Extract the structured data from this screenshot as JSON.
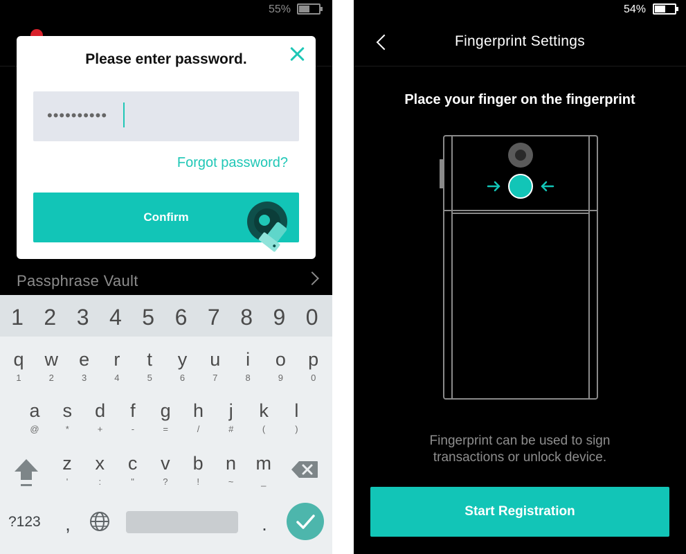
{
  "left": {
    "status_bar": {
      "battery_text": "55%",
      "battery_level": 0.55
    },
    "dialog": {
      "title": "Please enter password.",
      "password_value": "••••••••••",
      "forgot_label": "Forgot password?",
      "confirm_label": "Confirm"
    },
    "vault_label": "Passphrase Vault",
    "keyboard": {
      "numbers": [
        "1",
        "2",
        "3",
        "4",
        "5",
        "6",
        "7",
        "8",
        "9",
        "0"
      ],
      "row1": [
        {
          "k": "q",
          "s": "1"
        },
        {
          "k": "w",
          "s": "2"
        },
        {
          "k": "e",
          "s": "3"
        },
        {
          "k": "r",
          "s": "4"
        },
        {
          "k": "t",
          "s": "5"
        },
        {
          "k": "y",
          "s": "6"
        },
        {
          "k": "u",
          "s": "7"
        },
        {
          "k": "i",
          "s": "8"
        },
        {
          "k": "o",
          "s": "9"
        },
        {
          "k": "p",
          "s": "0"
        }
      ],
      "row2": [
        {
          "k": "a",
          "s": "@"
        },
        {
          "k": "s",
          "s": "*"
        },
        {
          "k": "d",
          "s": "+"
        },
        {
          "k": "f",
          "s": "-"
        },
        {
          "k": "g",
          "s": "="
        },
        {
          "k": "h",
          "s": "/"
        },
        {
          "k": "j",
          "s": "#"
        },
        {
          "k": "k",
          "s": "("
        },
        {
          "k": "l",
          "s": ")"
        }
      ],
      "row3": [
        {
          "k": "z",
          "s": "'"
        },
        {
          "k": "x",
          "s": ":"
        },
        {
          "k": "c",
          "s": "\""
        },
        {
          "k": "v",
          "s": "?"
        },
        {
          "k": "b",
          "s": "!"
        },
        {
          "k": "n",
          "s": "~"
        },
        {
          "k": "m",
          "s": "_"
        }
      ],
      "sym_label": "?123",
      "comma": ",",
      "period": "."
    }
  },
  "right": {
    "status_bar": {
      "battery_text": "54%",
      "battery_level": 0.54
    },
    "header_title": "Fingerprint Settings",
    "instruction": "Place your finger on the fingerprint",
    "description": "Fingerprint can be used to sign transactions or unlock device.",
    "start_label": "Start Registration"
  },
  "colors": {
    "accent": "#12c5b7",
    "close_icon": "#1fc7b6",
    "field_bg": "#e3e6ed",
    "keyboard_bg": "#eceff1",
    "enter_key": "#4db6ac"
  }
}
